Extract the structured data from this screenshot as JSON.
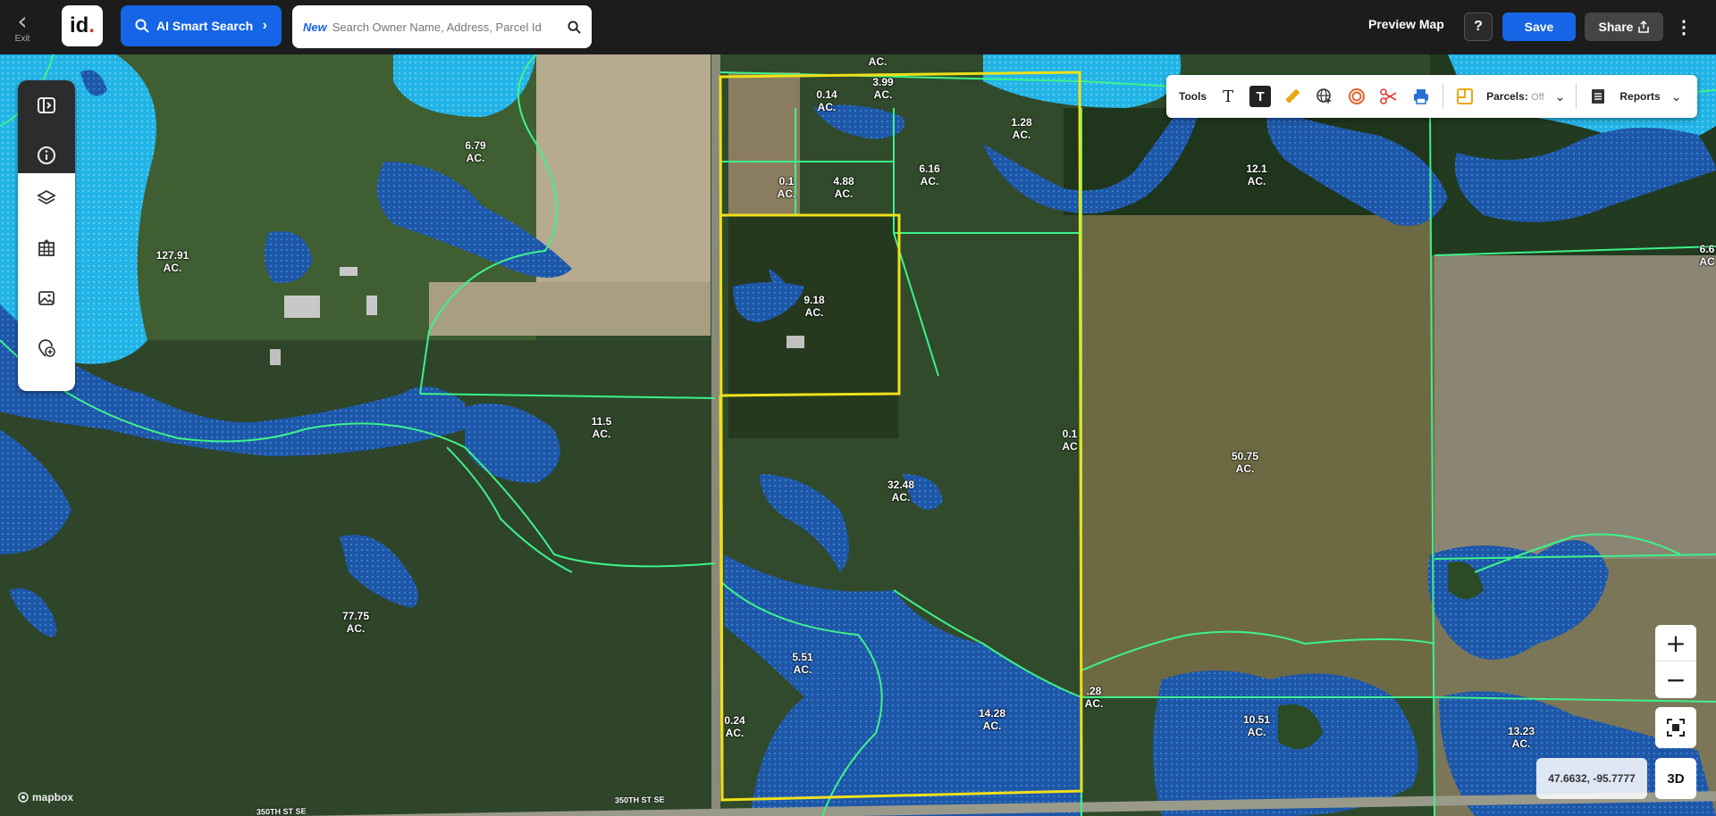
{
  "topbar": {
    "exit_label": "Exit",
    "logo_text": "id",
    "ai_search_label": "AI Smart Search",
    "search": {
      "new_badge": "New",
      "placeholder": "Search Owner Name, Address, Parcel Id"
    },
    "preview_map_label": "Preview Map",
    "help_label": "?",
    "save_label": "Save",
    "share_label": "Share"
  },
  "toolbar": {
    "tools_label": "Tools",
    "parcels_label": "Parcels:",
    "parcels_state": "Off",
    "reports_label": "Reports"
  },
  "sidebar": {
    "items": [
      {
        "icon": "collapse-sidebar-icon"
      },
      {
        "icon": "info-icon"
      },
      {
        "icon": "layers-icon"
      },
      {
        "icon": "grid-table-icon"
      },
      {
        "icon": "image-icon"
      },
      {
        "icon": "add-location-icon"
      }
    ]
  },
  "map": {
    "parcels": [
      {
        "acres": "127.91",
        "unit": "AC."
      },
      {
        "acres": "6.79",
        "unit": "AC."
      },
      {
        "acres": "0.14",
        "unit": "AC."
      },
      {
        "acres": "3.99",
        "unit": "AC."
      },
      {
        "acres": "1.28",
        "unit": "AC."
      },
      {
        "acres": "0.1",
        "unit": "AC."
      },
      {
        "acres": "4.88",
        "unit": "AC."
      },
      {
        "acres": "6.16",
        "unit": "AC."
      },
      {
        "acres": "12.1",
        "unit": "AC."
      },
      {
        "acres": "6.6",
        "unit": "AC"
      },
      {
        "acres": "9.18",
        "unit": "AC."
      },
      {
        "acres": "11.5",
        "unit": "AC."
      },
      {
        "acres": "0.1",
        "unit": "AC"
      },
      {
        "acres": "50.75",
        "unit": "AC."
      },
      {
        "acres": "32.48",
        "unit": "AC."
      },
      {
        "acres": "77.75",
        "unit": "AC."
      },
      {
        "acres": "5.51",
        "unit": "AC."
      },
      {
        "acres": "14.28",
        "unit": "AC."
      },
      {
        "acres": ".28",
        "unit": "AC."
      },
      {
        "acres": "0.24",
        "unit": "AC."
      },
      {
        "acres": "10.51",
        "unit": "AC."
      },
      {
        "acres": "13.23",
        "unit": "AC."
      },
      {
        "acres": "AC.",
        "unit": ""
      }
    ],
    "roads": [
      "350TH ST SE",
      "350TH ST SE"
    ],
    "attribution": "mapbox",
    "coordinates": "47.6632, -95.7777",
    "btn_3d": "3D",
    "colors": {
      "parcel_line": "#3df28a",
      "selection": "#f0e01a",
      "wetland": "#1e5fb0",
      "water": "#29b6e8"
    }
  }
}
